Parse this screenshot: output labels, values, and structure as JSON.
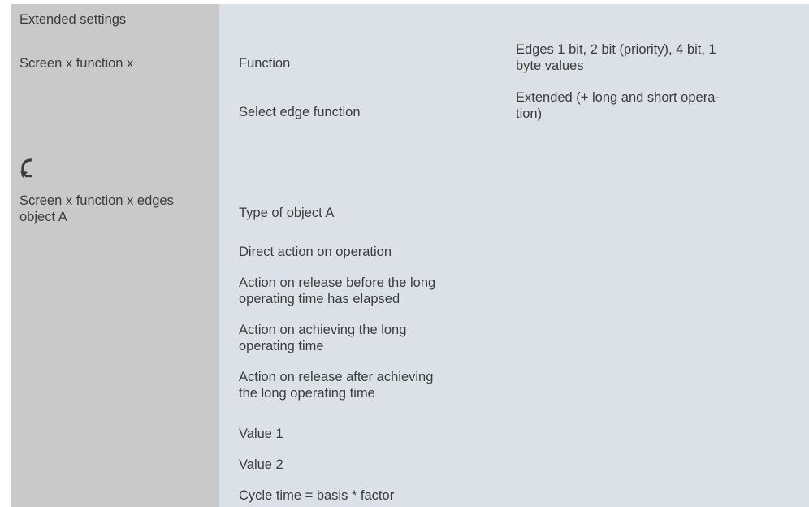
{
  "section_title": "Extended settings",
  "group1": {
    "label": "Screen x function x",
    "rows": [
      {
        "parameter": "Function",
        "value": "Edges 1 bit, 2 bit (priority), 4 bit, 1 byte values",
        "value_lines": [
          "Edges 1 bit, 2 bit (priority), 4 bit, 1",
          "byte values"
        ]
      },
      {
        "parameter": "Select edge function",
        "value": "Extended (+ long and short operation)",
        "value_lines": [
          "Extended (+ long and short opera-",
          "tion)"
        ]
      }
    ]
  },
  "icon": "curved-arrow-down-icon",
  "group2": {
    "label_lines": [
      "Screen x function x edges",
      "object A"
    ],
    "parameters": [
      "Type of object A",
      "Direct action on operation",
      "Action on release before the long operating time has elapsed",
      "Action on achieving the long operating time",
      "Action on release after achieving the long operating time",
      "Value 1",
      "Value 2",
      "Cycle time = basis * factor"
    ],
    "parameter_lines": [
      [
        "Type of object A"
      ],
      [
        "Direct action on operation"
      ],
      [
        "Action on release before the long",
        "operating time has elapsed"
      ],
      [
        "Action on achieving the long",
        "operating time"
      ],
      [
        "Action on release after achieving",
        "the long operating time"
      ],
      [
        "Value 1"
      ],
      [
        "Value 2"
      ],
      [
        "Cycle time = basis * factor"
      ]
    ]
  },
  "colors": {
    "left_column": "#c9c9c9",
    "content_area": "#dbe1e7",
    "text": "#3d3d3d"
  }
}
